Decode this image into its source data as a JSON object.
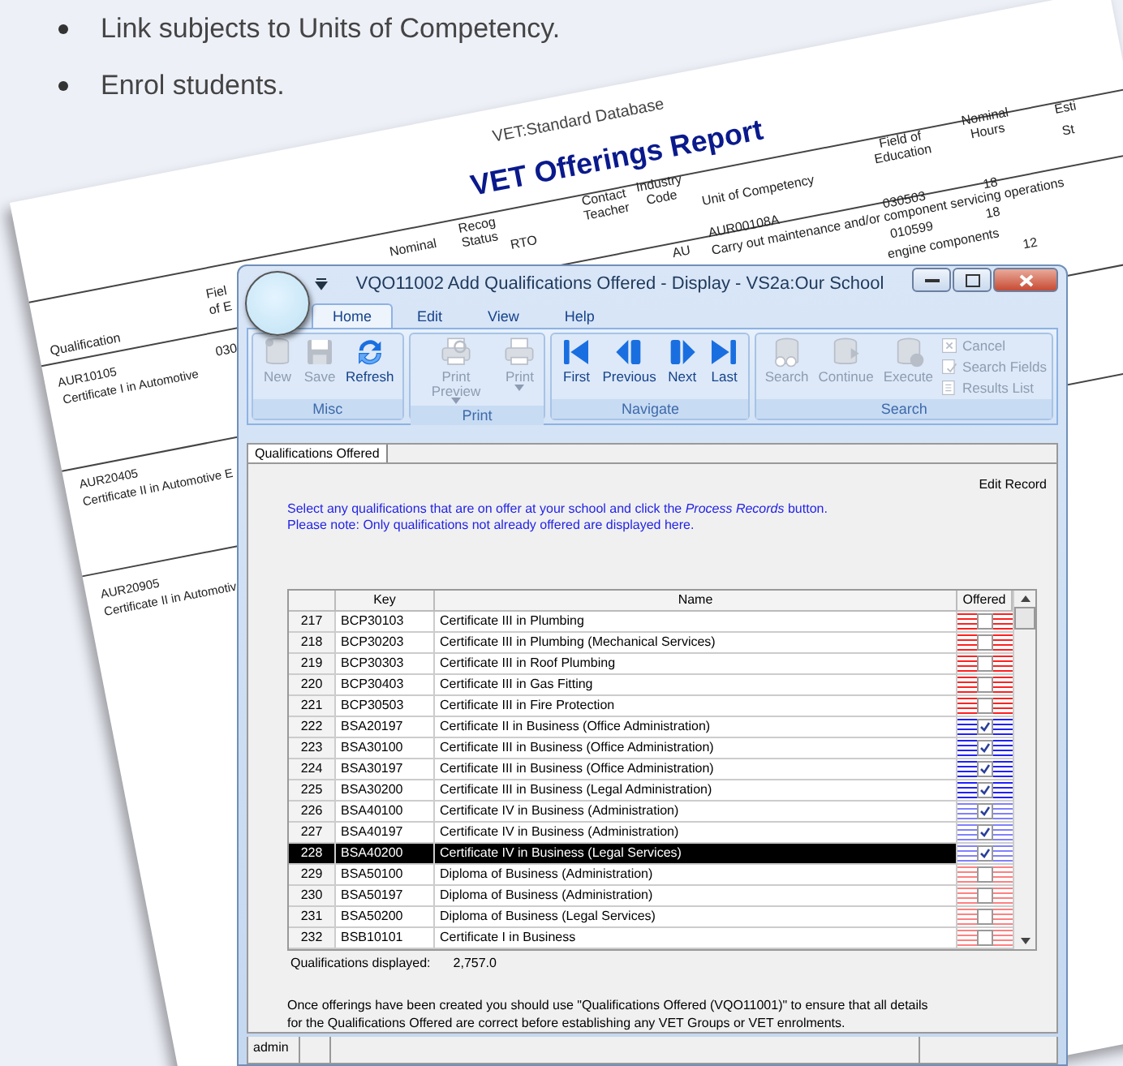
{
  "bullets": [
    "Link subjects to Units of Competency.",
    "Enrol students."
  ],
  "report": {
    "subtitle": "VET:Standard Database",
    "title": "VET Offerings Report",
    "headers": [
      "Nominal",
      "Recog Status",
      "RTO",
      "Contact Teacher",
      "Industry Code",
      "Unit of Competency",
      "Field of Education",
      "Nominal Hours",
      "Esti",
      "St",
      "Fiel",
      "of E",
      "Qualification"
    ],
    "cells": [
      "AU",
      "AUR00108A",
      "Carry out maintenance and/or component servicing operations",
      "030503",
      "18",
      "010599",
      "18",
      "engine components",
      "12",
      "030",
      "AUR10105",
      "Certificate I in Automotive",
      "AUR20405",
      "Certificate II in Automotive E",
      "AUR20905",
      "Certificate II in Automotiv"
    ]
  },
  "window": {
    "title": "VQO11002 Add Qualifications Offered - Display - VS2a:Our School",
    "tabs": [
      {
        "label": "Home",
        "selected": true
      },
      {
        "label": "Edit",
        "selected": false
      },
      {
        "label": "View",
        "selected": false
      },
      {
        "label": "Help",
        "selected": false
      }
    ],
    "ribbon_groups": [
      {
        "label": "Misc",
        "buttons": [
          {
            "label": "New",
            "kind": "new",
            "disabled": true,
            "dropdown": false,
            "small": false
          },
          {
            "label": "Save",
            "kind": "save",
            "disabled": true,
            "dropdown": false,
            "small": false
          },
          {
            "label": "Refresh",
            "kind": "refresh",
            "disabled": false,
            "dropdown": false,
            "small": false
          }
        ]
      },
      {
        "label": "Print",
        "buttons": [
          {
            "label": "Print Preview",
            "kind": "preview",
            "disabled": true,
            "dropdown": true,
            "small": false
          },
          {
            "label": "Print",
            "kind": "print",
            "disabled": true,
            "dropdown": true,
            "small": false
          }
        ]
      },
      {
        "label": "Navigate",
        "buttons": [
          {
            "label": "First",
            "kind": "first",
            "disabled": false,
            "dropdown": false,
            "small": false
          },
          {
            "label": "Previous",
            "kind": "previous",
            "disabled": false,
            "dropdown": false,
            "small": false
          },
          {
            "label": "Next",
            "kind": "next",
            "disabled": false,
            "dropdown": false,
            "small": false
          },
          {
            "label": "Last",
            "kind": "last",
            "disabled": false,
            "dropdown": false,
            "small": false
          }
        ]
      },
      {
        "label": "Search",
        "buttons": [
          {
            "label": "Search",
            "kind": "search",
            "disabled": true,
            "dropdown": false,
            "small": false
          },
          {
            "label": "Continue",
            "kind": "continue",
            "disabled": true,
            "dropdown": false,
            "small": false
          },
          {
            "label": "Execute",
            "kind": "execute",
            "disabled": true,
            "dropdown": false,
            "small": false
          },
          {
            "label": "Cancel",
            "kind": "cancel",
            "disabled": true,
            "dropdown": false,
            "small": true
          },
          {
            "label": "Search Fields",
            "kind": "fields",
            "disabled": true,
            "dropdown": false,
            "small": true
          },
          {
            "label": "Results List",
            "kind": "results",
            "disabled": true,
            "dropdown": false,
            "small": true
          }
        ]
      }
    ],
    "doc_tabs": [
      {
        "label": "Qualifications Offered",
        "selected": true
      }
    ],
    "mode": "Edit Record",
    "instructions": [
      "Select any qualifications that are on offer at your school and click the *Process Records* button.",
      "Please note: Only qualifications not already offered are displayed here."
    ],
    "table": {
      "columns": [
        "Key",
        "Name",
        "Offered"
      ],
      "rows": [
        {
          "number": "217",
          "key": "BCP30103",
          "name": "Certificate III in Plumbing",
          "offered": false,
          "color": "#ff2020",
          "selected": false
        },
        {
          "number": "218",
          "key": "BCP30203",
          "name": "Certificate III in Plumbing (Mechanical Services)",
          "offered": false,
          "color": "#ff2020",
          "selected": false
        },
        {
          "number": "219",
          "key": "BCP30303",
          "name": "Certificate III in Roof Plumbing",
          "offered": false,
          "color": "#ff2020",
          "selected": false
        },
        {
          "number": "220",
          "key": "BCP30403",
          "name": "Certificate III in Gas Fitting",
          "offered": false,
          "color": "#ff2020",
          "selected": false
        },
        {
          "number": "221",
          "key": "BCP30503",
          "name": "Certificate III in Fire Protection",
          "offered": false,
          "color": "#ff2020",
          "selected": false
        },
        {
          "number": "222",
          "key": "BSA20197",
          "name": "Certificate II in Business (Office Administration)",
          "offered": true,
          "color": "#2020ff",
          "selected": false
        },
        {
          "number": "223",
          "key": "BSA30100",
          "name": "Certificate III in Business (Office Administration)",
          "offered": true,
          "color": "#2020ff",
          "selected": false
        },
        {
          "number": "224",
          "key": "BSA30197",
          "name": "Certificate III in Business (Office Administration)",
          "offered": true,
          "color": "#2020ff",
          "selected": false
        },
        {
          "number": "225",
          "key": "BSA30200",
          "name": "Certificate III in Business (Legal Administration)",
          "offered": true,
          "color": "#2020ff",
          "selected": false
        },
        {
          "number": "226",
          "key": "BSA40100",
          "name": "Certificate IV in Business (Administration)",
          "offered": true,
          "color": "#8080ff",
          "selected": false
        },
        {
          "number": "227",
          "key": "BSA40197",
          "name": "Certificate IV in Business (Administration)",
          "offered": true,
          "color": "#8080ff",
          "selected": false
        },
        {
          "number": "228",
          "key": "BSA40200",
          "name": "Certificate IV in Business (Legal Services)",
          "offered": true,
          "color": "#8080ff",
          "selected": true
        },
        {
          "number": "229",
          "key": "BSA50100",
          "name": "Diploma of Business (Administration)",
          "offered": false,
          "color": "#ff8080",
          "selected": false
        },
        {
          "number": "230",
          "key": "BSA50197",
          "name": "Diploma of Business (Administration)",
          "offered": false,
          "color": "#ff8080",
          "selected": false
        },
        {
          "number": "231",
          "key": "BSA50200",
          "name": "Diploma of Business (Legal Services)",
          "offered": false,
          "color": "#ff8080",
          "selected": false
        },
        {
          "number": "232",
          "key": "BSB10101",
          "name": "Certificate I in Business",
          "offered": false,
          "color": "#ff8080",
          "selected": false
        }
      ]
    },
    "summary_label": "Qualifications displayed:",
    "summary_value": "2,757.0",
    "note": "Once offerings have been created you should use \"Qualifications Offered (VQO11001)\" to ensure that all details for the Qualifications Offered are correct before establishing any VET Groups or VET enrolments.",
    "status_bar": {
      "user": "admin"
    }
  }
}
